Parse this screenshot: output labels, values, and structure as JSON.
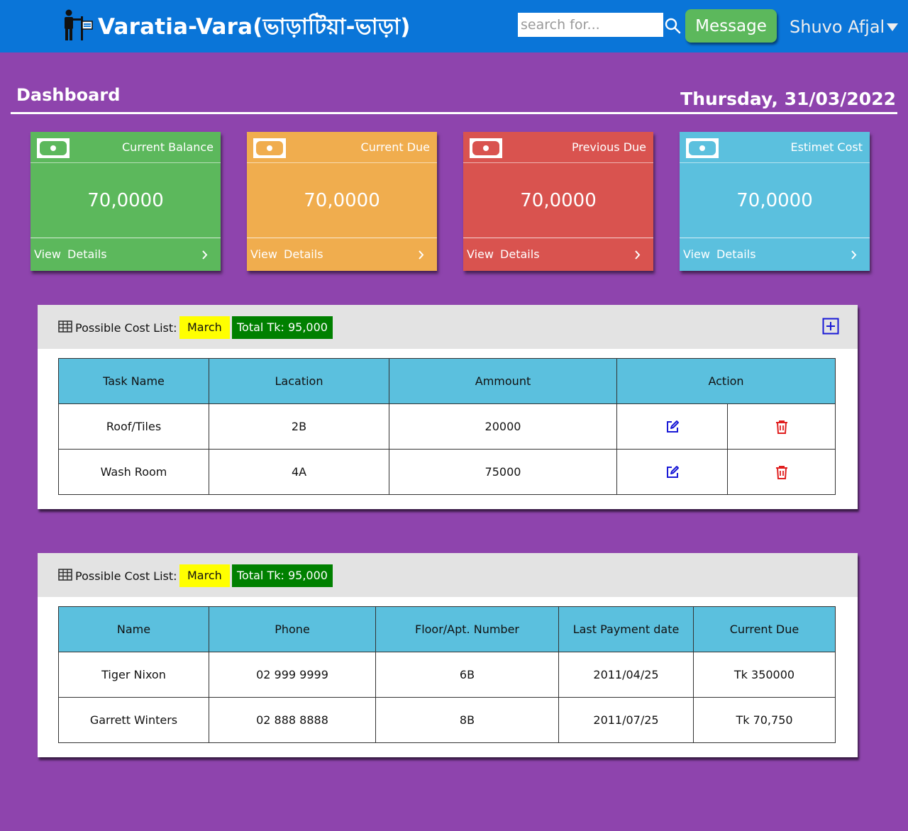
{
  "header": {
    "app_title": "Varatia-Vara(ভাড়াটিয়া-ভাড়া)",
    "search_placeholder": "search for...",
    "message_button": "Message",
    "user_name": "Shuvo Afjal",
    "brand_color": "#0a75d8"
  },
  "dashboard": {
    "title": "Dashboard",
    "date": "Thursday, 31/03/2022"
  },
  "cards": [
    {
      "label": "Current Balance",
      "value": "70,0000",
      "link": "View Details",
      "color": "#5cb85c",
      "icon": "money-icon"
    },
    {
      "label": "Current Due",
      "value": "70,0000",
      "link": "View Details",
      "color": "#f0ad4e",
      "icon": "money-icon"
    },
    {
      "label": "Previous Due",
      "value": "70,0000",
      "link": "View Details",
      "color": "#d9534f",
      "icon": "money-icon"
    },
    {
      "label": "Estimet Cost",
      "value": "70,0000",
      "link": "View Details",
      "color": "#5bc0de",
      "icon": "money-icon"
    }
  ],
  "cost_panel": {
    "title": "Possible Cost List:",
    "month": "March",
    "total": "Total Tk: 95,000",
    "columns": [
      "Task Name",
      "Lacation",
      "Ammount",
      "Action"
    ],
    "rows": [
      {
        "task": "Roof/Tiles",
        "location": "2B",
        "amount": "20000"
      },
      {
        "task": "Wash Room",
        "location": "4A",
        "amount": "75000"
      }
    ]
  },
  "tenant_panel": {
    "title": "Possible Cost List:",
    "month": "March",
    "total": "Total Tk: 95,000",
    "columns": [
      "Name",
      "Phone",
      "Floor/Apt. Number",
      "Last Payment date",
      "Current Due"
    ],
    "rows": [
      {
        "name": "Tiger Nixon",
        "phone": "02 999 9999",
        "floor": "6B",
        "last_payment": "2011/04/25",
        "due": "Tk 350000"
      },
      {
        "name": "Garrett Winters",
        "phone": "02 888 8888",
        "floor": "8B",
        "last_payment": "2011/07/25",
        "due": "Tk 70,750"
      }
    ]
  }
}
